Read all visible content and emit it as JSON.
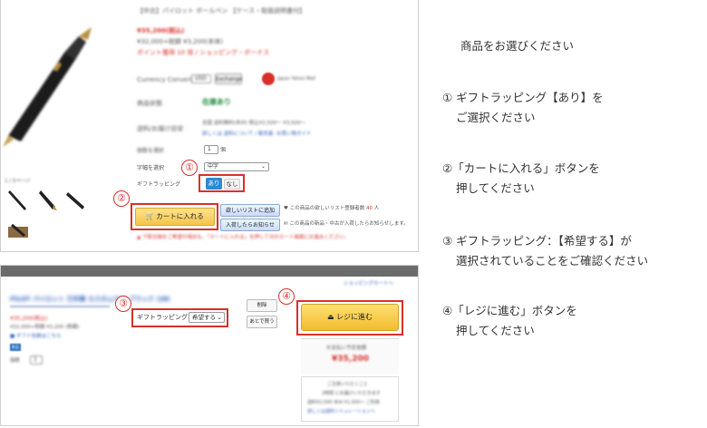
{
  "top_panel": {
    "product_title_blur": "【中古】パイロット ボールペン 【ケース・取扱説明書付】",
    "price": "¥35,200(税込)",
    "price_sub": "¥32,000+税額 ¥3,200(本体)",
    "points_line": "ポイント獲得 10 倍 / ショッピング・ボーナス",
    "currency_label": "Currency Converter",
    "currency_select": "USD",
    "currency_button": "Exchange",
    "partner_label": "Japan Yahoo Mall",
    "stock_label": "商品状態",
    "stock_value": "在庫あり",
    "shipping_label": "送料/お届け目安",
    "shipping_value1": "全国 送料無料(本州) 税込¥2,500〜 ¥3,500〜",
    "shipping_value2": "詳しくは 送料について / 販売者: お買い物ガイド",
    "qty_label": "個数を選択",
    "qty_value": "1",
    "qty_unit": "個",
    "engrave_label": "字幅を選択",
    "engrave_value": "中字",
    "gift_label": "ギフトラッピング",
    "gift_yes": "あり",
    "gift_no": "なし",
    "thumbs_label": "1 / 5ページ",
    "cart_button": "カートに入れる",
    "wishlist_button": "欲しいリストに追加",
    "notify_button": "入荷したらお知らせ",
    "wishlist_text_prefix": "この商品の欲しいリスト登録者数",
    "wishlist_count": "40",
    "wishlist_unit": "人",
    "notify_text": "この商品の新品・中古が入荷したらお知らせします。",
    "warning_text": "下取交換をご希望の場合も、「カートに入れる」を押して次のカート画面にお進みください。"
  },
  "bottom_panel": {
    "top_link": "ショッピングカートへ",
    "product_name_blur": "PILOT パイロット 万年筆 カスタム743 ブラック 18K",
    "price": "¥35,200(税込)",
    "price_sub": "¥32,000+税額 ¥3,200 (税額)",
    "gift_link": "ギフト包装はこちら",
    "badge": "新品",
    "qty_label": "個数",
    "qty_value": "1",
    "gift_label": "ギフトラッピング：",
    "gift_select": "希望する",
    "delete_button": "削除",
    "later_button": "あとで買う",
    "checkout_button": "レジに進む",
    "total_label": "お支払い予定金額",
    "total_value": "¥35,200",
    "note1": "ご注意いただくこと",
    "note2": "2時間 にお届けいただきます",
    "note3": "送料¥2,500 本州 ¥1,500〜 ご利用",
    "note4": "詳しくは送料シミュレーションへ"
  },
  "callouts": [
    "①",
    "②",
    "③",
    "④"
  ],
  "instructions": {
    "title": "商品をお選びください",
    "step1_line1": "① ギフトラッピング【あり】を",
    "step1_line2": "ご選択ください",
    "step2_line1": "②「カートに入れる」ボタンを",
    "step2_line2": "押してください",
    "step3_line1": "③ ギフトラッピング：【希望する】が",
    "step3_line2": "選択されていることをご確認ください",
    "step4_line1": "④「レジに進む」ボタンを",
    "step4_line2": "押してください"
  },
  "colors": {
    "accent_red": "#d9302a",
    "cart_yellow": "#f3c54a",
    "gift_blue": "#2b8ad6"
  }
}
